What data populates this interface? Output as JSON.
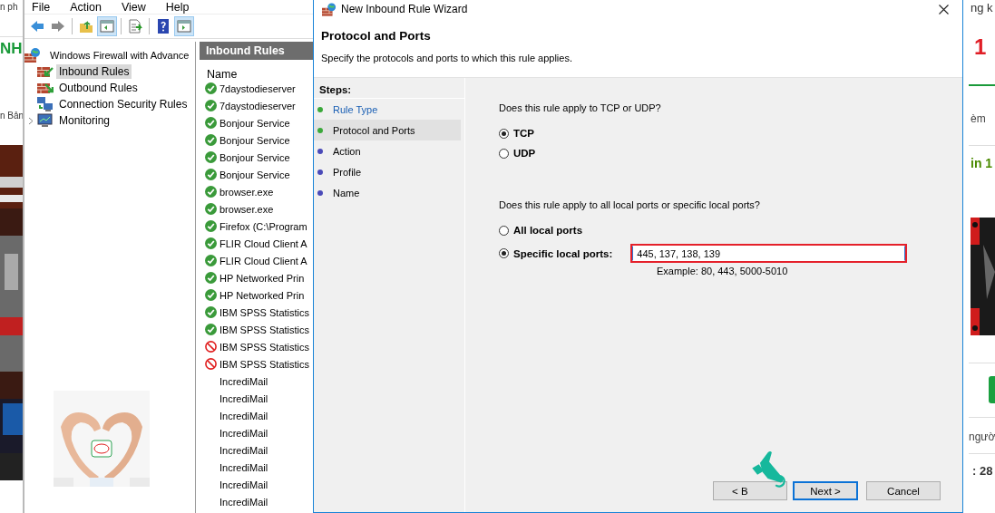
{
  "web_page": {
    "left_texts": [
      {
        "text": "n ph",
        "kind": "plain"
      },
      {
        "text": "NH",
        "kind": "brand"
      },
      {
        "text": "n Bản",
        "kind": "plain"
      }
    ],
    "right_texts": [
      {
        "text": "ng k",
        "kind": "plain"
      },
      {
        "text": "1",
        "kind": "brand"
      },
      {
        "text": "èm",
        "kind": "small"
      },
      {
        "text": "in 1",
        "kind": "promo"
      },
      {
        "text": "ngườ",
        "kind": "small"
      },
      {
        "text": ": 28",
        "kind": "bold"
      }
    ]
  },
  "mmc": {
    "menu": [
      "File",
      "Action",
      "View",
      "Help"
    ],
    "toolbar": [
      {
        "kind": "back",
        "on": false
      },
      {
        "kind": "forward",
        "on": false
      },
      {
        "kind": "up",
        "on": false
      },
      {
        "kind": "tree",
        "on": true
      },
      {
        "kind": "export",
        "on": false
      },
      {
        "kind": "help",
        "on": false
      },
      {
        "kind": "pane",
        "on": true
      }
    ],
    "tree": {
      "label": "Windows Firewall with Advance",
      "children": [
        {
          "label": "Inbound Rules",
          "kind": "inbound",
          "selected": true
        },
        {
          "label": "Outbound Rules",
          "kind": "outbound",
          "selected": false
        },
        {
          "label": "Connection Security Rules",
          "kind": "security",
          "selected": false
        },
        {
          "label": "Monitoring",
          "kind": "monitor",
          "selected": false,
          "expanded": false
        }
      ]
    },
    "rules": {
      "title": "Inbound Rules",
      "column": "Name",
      "rows": [
        {
          "name": "7daystodieserver",
          "kind": "allow"
        },
        {
          "name": "7daystodieserver",
          "kind": "allow"
        },
        {
          "name": "Bonjour Service",
          "kind": "allow"
        },
        {
          "name": "Bonjour Service",
          "kind": "allow"
        },
        {
          "name": "Bonjour Service",
          "kind": "allow"
        },
        {
          "name": "Bonjour Service",
          "kind": "allow"
        },
        {
          "name": "browser.exe",
          "kind": "allow"
        },
        {
          "name": "browser.exe",
          "kind": "allow"
        },
        {
          "name": "Firefox (C:\\Program",
          "kind": "allow"
        },
        {
          "name": "FLIR Cloud Client A",
          "kind": "allow"
        },
        {
          "name": "FLIR Cloud Client A",
          "kind": "allow"
        },
        {
          "name": "HP Networked Prin",
          "kind": "allow"
        },
        {
          "name": "HP Networked Prin",
          "kind": "allow"
        },
        {
          "name": "IBM SPSS Statistics",
          "kind": "allow"
        },
        {
          "name": "IBM SPSS Statistics",
          "kind": "allow"
        },
        {
          "name": "IBM SPSS Statistics",
          "kind": "block"
        },
        {
          "name": "IBM SPSS Statistics",
          "kind": "block"
        },
        {
          "name": "IncrediMail",
          "kind": "none"
        },
        {
          "name": "IncrediMail",
          "kind": "none"
        },
        {
          "name": "IncrediMail",
          "kind": "none"
        },
        {
          "name": "IncrediMail",
          "kind": "none"
        },
        {
          "name": "IncrediMail",
          "kind": "none"
        },
        {
          "name": "IncrediMail",
          "kind": "none"
        },
        {
          "name": "IncrediMail",
          "kind": "none"
        },
        {
          "name": "IncrediMail",
          "kind": "none"
        }
      ]
    }
  },
  "wizard": {
    "title": "New Inbound Rule Wizard",
    "heading": "Protocol and Ports",
    "subtitle": "Specify the protocols and ports to which this rule applies.",
    "steps_title": "Steps:",
    "steps": [
      {
        "label": "Rule Type",
        "selected": false,
        "reached": true
      },
      {
        "label": "Protocol and Ports",
        "selected": true,
        "reached": true
      },
      {
        "label": "Action",
        "selected": false,
        "reached": false
      },
      {
        "label": "Profile",
        "selected": false,
        "reached": false
      },
      {
        "label": "Name",
        "selected": false,
        "reached": false
      }
    ],
    "protocol_question": "Does this rule apply to TCP or UDP?",
    "protocols": [
      {
        "label": "TCP",
        "selected": true
      },
      {
        "label": "UDP",
        "selected": false
      }
    ],
    "ports_question": "Does this rule apply to all local ports or specific local ports?",
    "port_options": [
      {
        "label": "All local ports",
        "selected": false
      },
      {
        "label": "Specific local ports:",
        "selected": true
      }
    ],
    "ports_field": {
      "value": "445, 137, 138, 139",
      "highlighted": true
    },
    "ports_example": "Example: 80, 443, 5000-5010",
    "buttons": [
      {
        "label": "< B",
        "kind": "back",
        "focused": false
      },
      {
        "label": "Next >",
        "kind": "next",
        "focused": true
      },
      {
        "label": "Cancel",
        "kind": "cancel",
        "focused": false
      }
    ]
  }
}
